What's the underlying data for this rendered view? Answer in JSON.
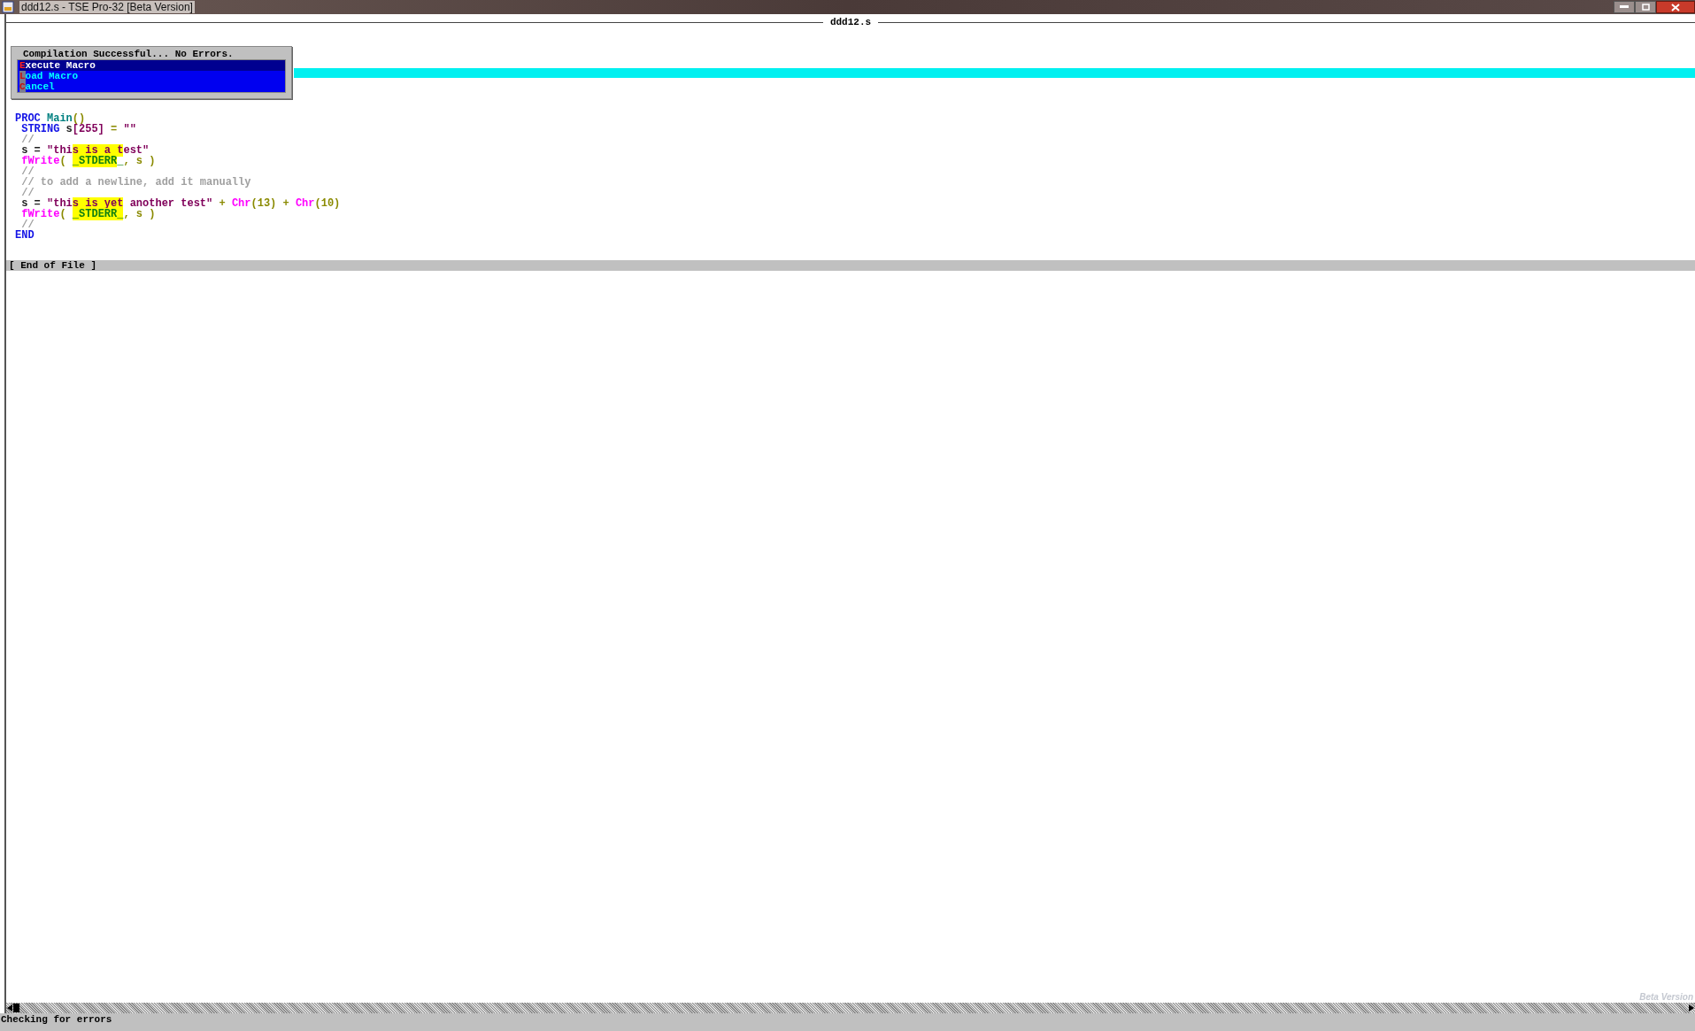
{
  "window": {
    "title": "ddd12.s - TSE Pro-32 [Beta Version]"
  },
  "editor": {
    "title": "ddd12.s",
    "code_lines": [
      [
        {
          "text": "PROC ",
          "kind": "keyword"
        },
        {
          "text": "Main",
          "kind": "func"
        },
        {
          "text": "()",
          "kind": "op"
        }
      ],
      [
        {
          "text": " STRING ",
          "kind": "keyword"
        },
        {
          "text": "s",
          "kind": "plain"
        },
        {
          "text": "[255]",
          "kind": "string"
        },
        {
          "text": " = ",
          "kind": "op"
        },
        {
          "text": "\"\"",
          "kind": "string"
        }
      ],
      [
        {
          "text": " //",
          "kind": "comment"
        }
      ],
      [
        {
          "text": " s = ",
          "kind": "plain"
        },
        {
          "text": "\"thi",
          "kind": "string"
        },
        {
          "text": "s is a t",
          "kind": "string",
          "highlighted": true
        },
        {
          "text": "est\"",
          "kind": "string"
        }
      ],
      [
        {
          "text": " fWrite",
          "kind": "builtin"
        },
        {
          "text": "( ",
          "kind": "op"
        },
        {
          "text": "_STDERR",
          "kind": "const",
          "highlighted": true
        },
        {
          "text": "_",
          "kind": "const"
        },
        {
          "text": ", s )",
          "kind": "op"
        }
      ],
      [
        {
          "text": " //",
          "kind": "comment"
        }
      ],
      [
        {
          "text": " // to add a newline, add it manually",
          "kind": "comment"
        }
      ],
      [
        {
          "text": " //",
          "kind": "comment"
        }
      ],
      [
        {
          "text": " s = ",
          "kind": "plain"
        },
        {
          "text": "\"thi",
          "kind": "string"
        },
        {
          "text": "s is yet",
          "kind": "string",
          "highlighted": true
        },
        {
          "text": " another test\"",
          "kind": "string"
        },
        {
          "text": " + ",
          "kind": "op"
        },
        {
          "text": "Chr",
          "kind": "builtin"
        },
        {
          "text": "(13)",
          "kind": "op"
        },
        {
          "text": " + ",
          "kind": "op"
        },
        {
          "text": "Chr",
          "kind": "builtin"
        },
        {
          "text": "(10)",
          "kind": "op"
        }
      ],
      [
        {
          "text": " fWrite",
          "kind": "builtin"
        },
        {
          "text": "( ",
          "kind": "op"
        },
        {
          "text": "_STDERR_",
          "kind": "const",
          "highlighted": true
        },
        {
          "text": ", s )",
          "kind": "op"
        }
      ],
      [
        {
          "text": " //",
          "kind": "comment"
        }
      ],
      [
        {
          "text": "END",
          "kind": "keyword"
        }
      ]
    ],
    "end_marker": "[ End of File ]",
    "corner_label": "Beta Version"
  },
  "dialog": {
    "title": "Compilation Successful... No Errors.",
    "items": [
      {
        "hotkey": "E",
        "rest": "xecute Macro",
        "selected": true
      },
      {
        "hotkey": "L",
        "rest": "oad Macro",
        "selected": false
      },
      {
        "hotkey": "C",
        "rest": "ancel",
        "selected": false
      }
    ]
  },
  "status_bar": {
    "text": "Checking for errors"
  }
}
